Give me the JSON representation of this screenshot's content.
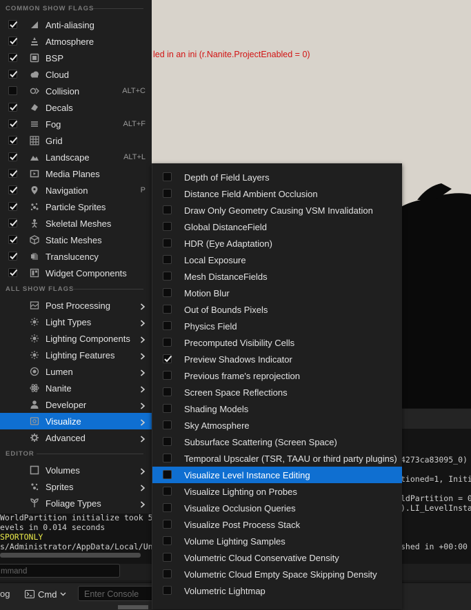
{
  "viewport": {
    "message": "led in an ini (r.Nanite.ProjectEnabled = 0)"
  },
  "output_log": {
    "lines_right": [
      "4273ca83095_0)",
      "tioned=1, Initi",
      "ldPartition = 0",
      ").LI_LevelInsta",
      "shed in +00:00"
    ],
    "lines_left": [
      "WorldPartition initialize took 5",
      "evels in 0.014 seconds",
      "SPORTONLY",
      "s/Administrator/AppData/Local/Un"
    ],
    "filter_placeholder": "mmand"
  },
  "bottom_bar": {
    "log_label": "og",
    "cmd_label": "Cmd",
    "console_placeholder": "Enter Console"
  },
  "menu": {
    "common_header": "COMMON SHOW FLAGS",
    "all_header": "ALL SHOW FLAGS",
    "editor_header": "EDITOR",
    "common_items": [
      {
        "label": "Anti-aliasing",
        "checked": true,
        "shortcut": "",
        "icon": "antialias-icon"
      },
      {
        "label": "Atmosphere",
        "checked": true,
        "shortcut": "",
        "icon": "atmosphere-icon"
      },
      {
        "label": "BSP",
        "checked": true,
        "shortcut": "",
        "icon": "bsp-icon"
      },
      {
        "label": "Cloud",
        "checked": true,
        "shortcut": "",
        "icon": "cloud-icon"
      },
      {
        "label": "Collision",
        "checked": false,
        "shortcut": "ALT+C",
        "icon": "collision-icon"
      },
      {
        "label": "Decals",
        "checked": true,
        "shortcut": "",
        "icon": "decal-icon"
      },
      {
        "label": "Fog",
        "checked": true,
        "shortcut": "ALT+F",
        "icon": "fog-icon"
      },
      {
        "label": "Grid",
        "checked": true,
        "shortcut": "",
        "icon": "grid-icon"
      },
      {
        "label": "Landscape",
        "checked": true,
        "shortcut": "ALT+L",
        "icon": "landscape-icon"
      },
      {
        "label": "Media Planes",
        "checked": true,
        "shortcut": "",
        "icon": "media-plane-icon"
      },
      {
        "label": "Navigation",
        "checked": true,
        "shortcut": "P",
        "icon": "navigation-pin-icon"
      },
      {
        "label": "Particle Sprites",
        "checked": true,
        "shortcut": "",
        "icon": "particle-icon"
      },
      {
        "label": "Skeletal Meshes",
        "checked": true,
        "shortcut": "",
        "icon": "skeletal-mesh-icon"
      },
      {
        "label": "Static Meshes",
        "checked": true,
        "shortcut": "",
        "icon": "static-mesh-icon"
      },
      {
        "label": "Translucency",
        "checked": true,
        "shortcut": "",
        "icon": "translucency-icon"
      },
      {
        "label": "Widget Components",
        "checked": true,
        "shortcut": "",
        "icon": "widget-icon"
      }
    ],
    "all_items": [
      {
        "label": "Post Processing",
        "icon": "post-process-icon"
      },
      {
        "label": "Light Types",
        "icon": "light-icon"
      },
      {
        "label": "Lighting Components",
        "icon": "light-icon"
      },
      {
        "label": "Lighting Features",
        "icon": "light-icon"
      },
      {
        "label": "Lumen",
        "icon": "lumen-icon"
      },
      {
        "label": "Nanite",
        "icon": "nanite-icon"
      },
      {
        "label": "Developer",
        "icon": "developer-icon"
      },
      {
        "label": "Visualize",
        "icon": "visualize-icon"
      },
      {
        "label": "Advanced",
        "icon": "advanced-icon"
      }
    ],
    "selected_all_item": "Visualize",
    "editor_items": [
      {
        "label": "Volumes",
        "icon": "volume-icon"
      },
      {
        "label": "Sprites",
        "icon": "sprite-icon"
      },
      {
        "label": "Foliage Types",
        "icon": "foliage-icon"
      }
    ]
  },
  "submenu": {
    "selected_item": "Visualize Level Instance Editing",
    "items": [
      {
        "label": "Depth of Field Layers",
        "checked": false
      },
      {
        "label": "Distance Field Ambient Occlusion",
        "checked": false
      },
      {
        "label": "Draw Only Geometry Causing VSM Invalidation",
        "checked": false
      },
      {
        "label": "Global DistanceField",
        "checked": false
      },
      {
        "label": "HDR (Eye Adaptation)",
        "checked": false
      },
      {
        "label": "Local Exposure",
        "checked": false
      },
      {
        "label": "Mesh DistanceFields",
        "checked": false
      },
      {
        "label": "Motion Blur",
        "checked": false
      },
      {
        "label": "Out of Bounds Pixels",
        "checked": false
      },
      {
        "label": "Physics Field",
        "checked": false
      },
      {
        "label": "Precomputed Visibility Cells",
        "checked": false
      },
      {
        "label": "Preview Shadows Indicator",
        "checked": true
      },
      {
        "label": "Previous frame's reprojection",
        "checked": false
      },
      {
        "label": "Screen Space Reflections",
        "checked": false
      },
      {
        "label": "Shading Models",
        "checked": false
      },
      {
        "label": "Sky Atmosphere",
        "checked": false
      },
      {
        "label": "Subsurface Scattering (Screen Space)",
        "checked": false
      },
      {
        "label": "Temporal Upscaler (TSR, TAAU or third party plugins)",
        "checked": false
      },
      {
        "label": "Visualize Level Instance Editing",
        "checked": false
      },
      {
        "label": "Visualize Lighting on Probes",
        "checked": false
      },
      {
        "label": "Visualize Occlusion Queries",
        "checked": false
      },
      {
        "label": "Visualize Post Process Stack",
        "checked": false
      },
      {
        "label": "Volume Lighting Samples",
        "checked": false
      },
      {
        "label": "Volumetric Cloud Conservative Density",
        "checked": false
      },
      {
        "label": "Volumetric Cloud Empty Space Skipping Density",
        "checked": false
      },
      {
        "label": "Volumetric Lightmap",
        "checked": false
      }
    ]
  }
}
